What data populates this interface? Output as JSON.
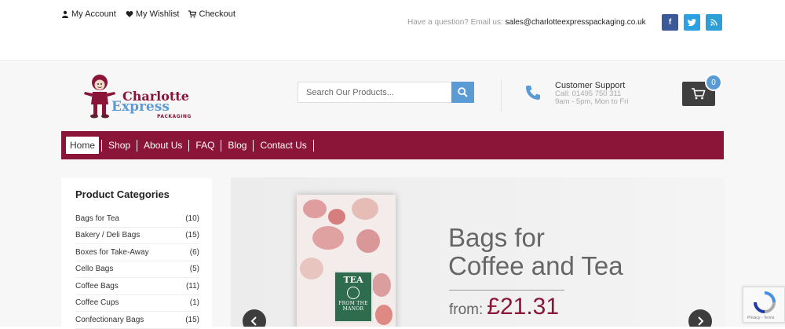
{
  "top": {
    "links": [
      "My Account",
      "My Wishlist",
      "Checkout"
    ],
    "contact_prefix": "Have a question? Email us:",
    "contact_email": "sales@charlotteexpresspackaging.co.uk",
    "social": [
      "facebook-icon",
      "twitter-icon",
      "rss-icon"
    ]
  },
  "logo": {
    "line1": "Charlotte",
    "line2": "Express",
    "line3": "PACKAGING"
  },
  "search": {
    "placeholder": "Search Our Products..."
  },
  "support": {
    "title": "Customer Support",
    "phone": "Call: 01495 750 311",
    "hours": "9am - 5pm, Mon to Fri"
  },
  "cart": {
    "count": "0"
  },
  "nav": {
    "items": [
      "Home",
      "Shop",
      "About Us",
      "FAQ",
      "Blog",
      "Contact Us"
    ],
    "active": "Home"
  },
  "categories": {
    "title": "Product Categories",
    "items": [
      {
        "name": "Bags for Tea",
        "count": "(10)"
      },
      {
        "name": "Bakery / Deli Bags",
        "count": "(15)"
      },
      {
        "name": "Boxes for Take-Away",
        "count": "(6)"
      },
      {
        "name": "Cello Bags",
        "count": "(5)"
      },
      {
        "name": "Coffee Bags",
        "count": "(11)"
      },
      {
        "name": "Coffee Cups",
        "count": "(1)"
      },
      {
        "name": "Confectionary Bags",
        "count": "(15)"
      }
    ]
  },
  "slide": {
    "headline1": "Bags for",
    "headline2": "Coffee and Tea",
    "from": "from:",
    "price": "£21.31",
    "bag_label_top": "TEA",
    "bag_label_bottom": "FROM THE MANOR"
  },
  "colors": {
    "brand": "#8a1538",
    "accent": "#5b9bd5"
  }
}
